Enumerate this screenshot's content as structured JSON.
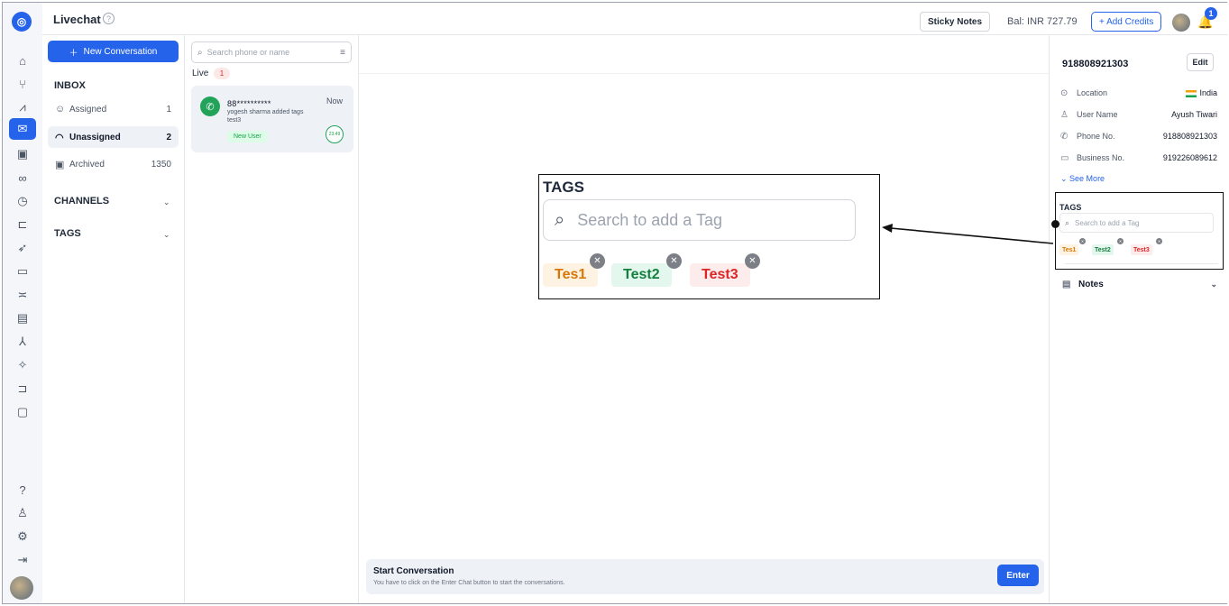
{
  "topbar": {
    "title": "Livechat",
    "sticky_notes": "Sticky Notes",
    "balance": "Bal: INR 727.79",
    "add_credits": "+ Add Credits",
    "notif_count": "1"
  },
  "inbox": {
    "new_conversation": "New Conversation",
    "inbox_label": "INBOX",
    "items": [
      {
        "label": "Assigned",
        "count": "1"
      },
      {
        "label": "Unassigned",
        "count": "2"
      },
      {
        "label": "Archived",
        "count": "1350"
      }
    ],
    "channels_label": "CHANNELS",
    "tags_label": "TAGS"
  },
  "convlist": {
    "search_placeholder": "Search phone or name",
    "live_label": "Live",
    "live_count": "1",
    "card": {
      "phone": "88**********",
      "time": "Now",
      "line1": "yogesh sharma added tags",
      "line2": "test3",
      "badge": "New User",
      "timer": "23:49"
    }
  },
  "chat": {
    "start_title": "Start Conversation",
    "start_sub": "You have to click on the Enter Chat button to start the conversations.",
    "enter_label": "Enter"
  },
  "zoom": {
    "title": "TAGS",
    "search_placeholder": "Search to add a Tag",
    "tags": [
      "Tes1",
      "Test2",
      "Test3"
    ]
  },
  "rpanel": {
    "phone": "918808921303",
    "edit_label": "Edit",
    "rows": [
      {
        "label": "Location",
        "value": "India"
      },
      {
        "label": "User Name",
        "value": "Ayush Tiwari"
      },
      {
        "label": "Phone No.",
        "value": "918808921303"
      },
      {
        "label": "Business No.",
        "value": "919226089612"
      }
    ],
    "see_more": "See More",
    "tags_title": "TAGS",
    "tags_search_placeholder": "Search to add a Tag",
    "tags": [
      "Tes1",
      "Test2",
      "Test3"
    ],
    "notes_label": "Notes"
  },
  "colors": {
    "accent": "#2563eb",
    "tag1_bg": "#fef3e2",
    "tag1_fg": "#d97706",
    "tag2_bg": "#e3f7ee",
    "tag2_fg": "#15803d",
    "tag3_bg": "#fdecec",
    "tag3_fg": "#dc2626"
  }
}
